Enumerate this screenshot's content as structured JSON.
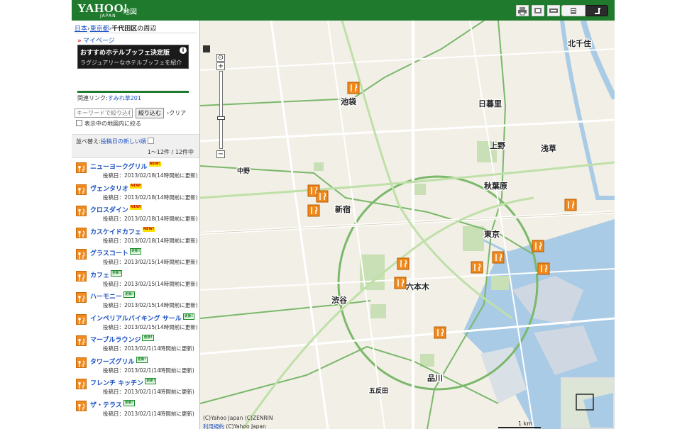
{
  "header": {
    "logo": "YAHOO!",
    "logo_sub": "JAPAN",
    "service": "地図"
  },
  "toolbar": {
    "buttons": [
      "print-icon",
      "share-icon",
      "map-mode-icon",
      "list-view-icon",
      "route-icon"
    ]
  },
  "breadcrumb": {
    "items": [
      "日本",
      "東京都",
      "千代田区"
    ],
    "current_suffix": "の周辺"
  },
  "mypage": "マイページ",
  "banner": {
    "title": "おすすめホテルブッフェ決定版",
    "subtitle": "ラグジュアリーなホテルブッフェを紹介"
  },
  "related": {
    "label": "関連リンク:",
    "link": "すみれ草201"
  },
  "search": {
    "placeholder": "キーワードで絞り込む",
    "button": "絞り込む",
    "clear": "クリア",
    "checkbox_label": "表示中の地図内に絞る"
  },
  "sort": {
    "label": "並べ替え:",
    "value": "投稿日の新しい順",
    "count": "1〜12件 / 12件中"
  },
  "list": [
    {
      "name": "ニューヨークグリル",
      "badge": "NEW!",
      "date": "投稿日：2013/02/18(14時間前に更新)"
    },
    {
      "name": "ヴェンタリオ",
      "badge": "NEW!",
      "date": "投稿日：2013/02/18(14時間前に更新)"
    },
    {
      "name": "クロスダイン",
      "badge": "NEW!",
      "date": "投稿日：2013/02/18(14時間前に更新)"
    },
    {
      "name": "カスケイドカフェ",
      "badge": "NEW!",
      "date": "投稿日：2013/02/18(14時間前に更新)"
    },
    {
      "name": "グラスコート",
      "badge": "更新!",
      "date": "投稿日：2013/02/15(14時間前に更新)"
    },
    {
      "name": "カフェ",
      "badge": "更新!",
      "date": "投稿日：2013/02/15(14時間前に更新)"
    },
    {
      "name": "ハーモニー",
      "badge": "更新!",
      "date": "投稿日：2013/02/15(14時間前に更新)"
    },
    {
      "name": "インペリアルバイキング サール",
      "badge": "更新!",
      "date": "投稿日：2013/02/15(14時間前に更新)"
    },
    {
      "name": "マーブルラウンジ",
      "badge": "更新!",
      "date": "投稿日：2013/02/1(14時間前に更新)"
    },
    {
      "name": "タワーズグリル",
      "badge": "更新!",
      "date": "投稿日：2013/02/1(14時間前に更新)"
    },
    {
      "name": "フレンチ キッチン",
      "badge": "更新!",
      "date": "投稿日：2013/02/1(14時間前に更新)"
    },
    {
      "name": "ザ・テラス",
      "badge": "更新!",
      "date": "投稿日：2013/02/1(14時間前に更新)"
    }
  ],
  "map": {
    "labels": [
      {
        "text": "北千住"
      },
      {
        "text": "池袋"
      },
      {
        "text": "日暮里"
      },
      {
        "text": "上野"
      },
      {
        "text": "浅草"
      },
      {
        "text": "秋葉原"
      },
      {
        "text": "新宿"
      },
      {
        "text": "東京"
      },
      {
        "text": "渋谷"
      },
      {
        "text": "品川"
      },
      {
        "text": "六本木"
      },
      {
        "text": "中野"
      },
      {
        "text": "五反田"
      }
    ],
    "copyright": "(C)Yahoo Japan (C)ZENRIN",
    "copyright2_link": "利用規約",
    "copyright2_rest": "(C)Yahoo Japan",
    "scale": "1 km",
    "colors": {
      "land": "#f2efe6",
      "water": "#a9cbe6",
      "green": "#c9dfb5",
      "rail": "#7ab86a",
      "pin": "#f08a1e"
    }
  }
}
